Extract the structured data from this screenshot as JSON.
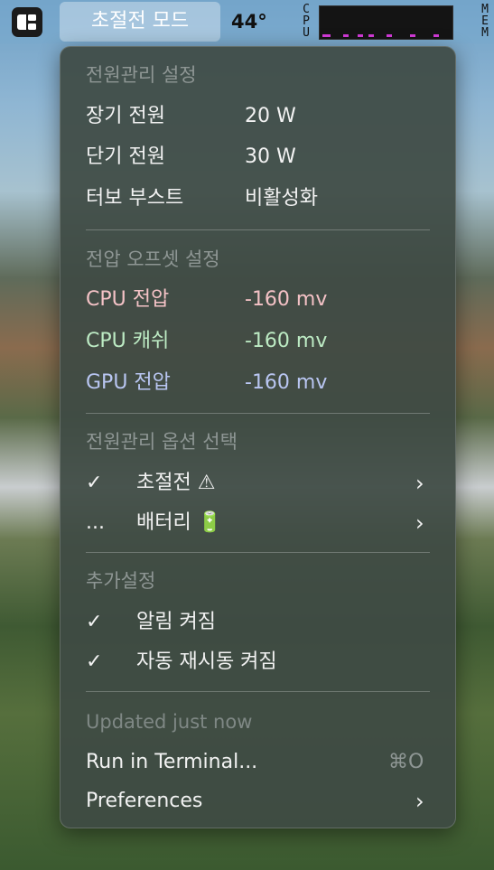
{
  "menubar": {
    "mode_label": "초절전 모드",
    "temperature": "44°",
    "cpu_label": [
      "C",
      "P",
      "U"
    ],
    "mem_label": [
      "M",
      "E",
      "M"
    ],
    "cpu_graph_color": "#d23ad8"
  },
  "menu": {
    "power_section": {
      "header": "전원관리 설정",
      "rows": [
        {
          "key": "장기 전원",
          "value": "20 W"
        },
        {
          "key": "단기 전원",
          "value": "30 W"
        },
        {
          "key": "터보 부스트",
          "value": "비활성화"
        }
      ]
    },
    "voltage_section": {
      "header": "전압 오프셋 설정",
      "rows": [
        {
          "key": "CPU 전압",
          "value": "-160 mv",
          "color": "#f4c2c6"
        },
        {
          "key": "CPU 캐쉬",
          "value": "-160 mv",
          "color": "#bdebc4"
        },
        {
          "key": "GPU 전압",
          "value": "-160 mv",
          "color": "#b9c6f2"
        }
      ]
    },
    "option_section": {
      "header": "전원관리 옵션 선택",
      "items": [
        {
          "mark": "✓",
          "label": "초절전 ⚠",
          "chevron": "›"
        },
        {
          "mark": "...",
          "label": "배터리 🔋",
          "chevron": "›"
        }
      ]
    },
    "extra_section": {
      "header": "추가설정",
      "items": [
        {
          "mark": "✓",
          "label": "알림 켜짐"
        },
        {
          "mark": "✓",
          "label": "자동 재시동 켜짐"
        }
      ]
    },
    "footer": {
      "status": "Updated just now",
      "run_label": "Run in Terminal...",
      "run_shortcut": "⌘O",
      "prefs_label": "Preferences",
      "prefs_chevron": "›"
    }
  }
}
